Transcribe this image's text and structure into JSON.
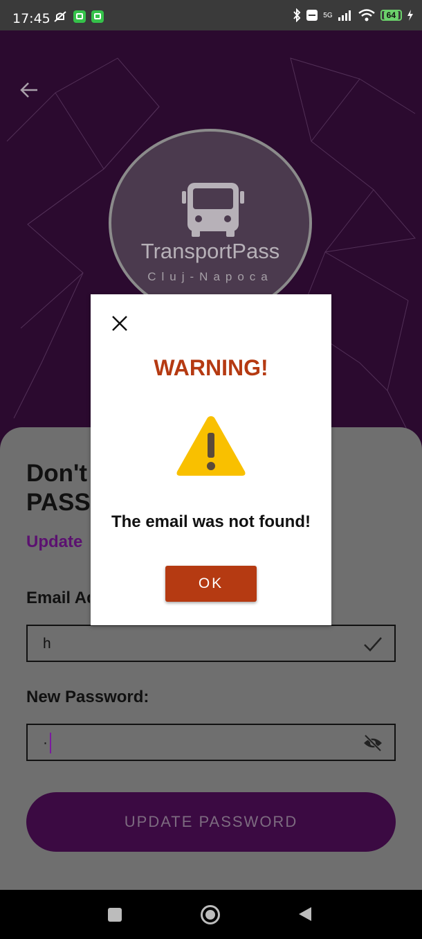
{
  "status_bar": {
    "time": "17:45",
    "battery_level": "64",
    "network_label": "5G",
    "icons": [
      "mute-icon",
      "app-notification-icon",
      "app-notification-icon",
      "bluetooth-icon",
      "volte-icon",
      "signal-icon",
      "wifi-icon",
      "battery-icon",
      "charging-icon"
    ]
  },
  "hero": {
    "logo_title": "TransportPass",
    "logo_subtitle": "Cluj-Napoca"
  },
  "form": {
    "heading_line1": "Don't",
    "heading_line2": "PASS",
    "subtitle": "Update",
    "email_label": "Email Ad",
    "email_value": "h",
    "password_label": "New Password:",
    "password_value": "·",
    "submit_label": "UPDATE PASSWORD"
  },
  "dialog": {
    "title": "WARNING!",
    "message": "The email was not found!",
    "ok_label": "OK"
  },
  "colors": {
    "brand_purple": "#5b1170",
    "warning_red": "#b53a12",
    "warning_yellow": "#f9c000"
  }
}
